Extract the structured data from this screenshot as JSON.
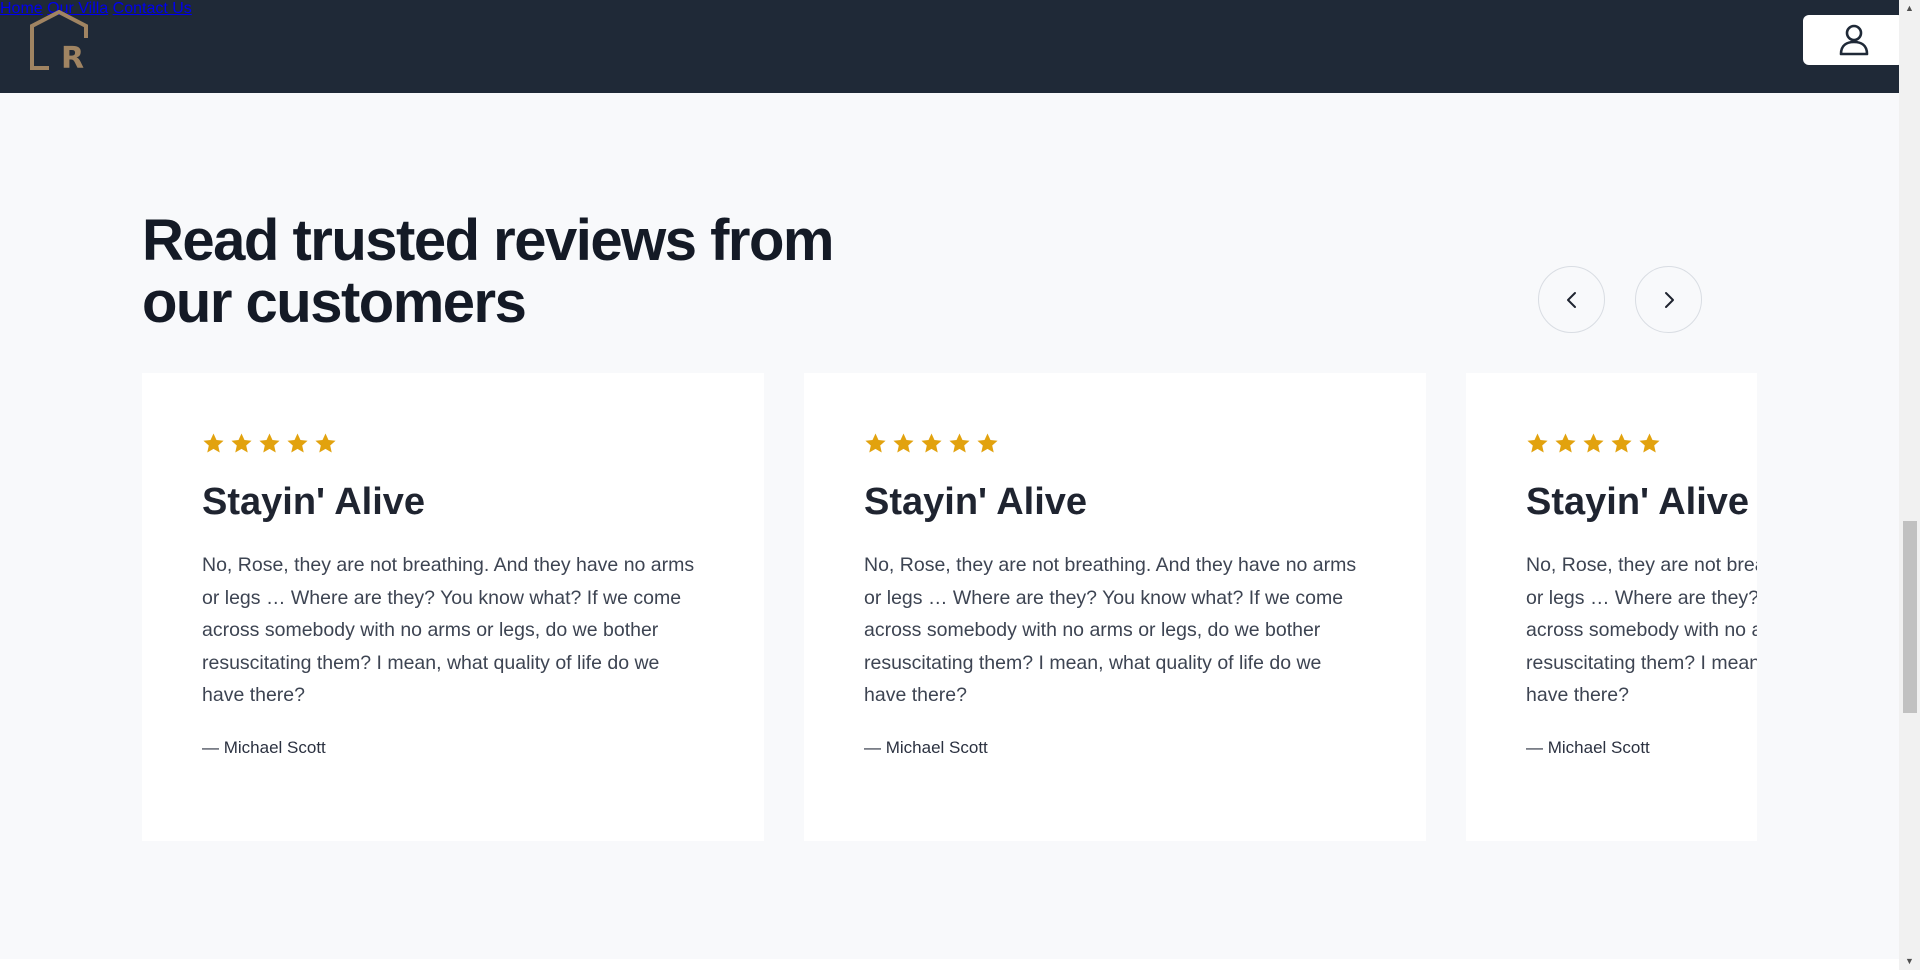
{
  "header": {
    "logo_alt": "LR",
    "nav": [
      {
        "label": "Home"
      },
      {
        "label": "Our Villa"
      },
      {
        "label": "Contact Us"
      }
    ],
    "user_icon": "user-icon"
  },
  "section": {
    "heading": "Read trusted reviews from our customers",
    "prev_icon": "chevron-left-icon",
    "next_icon": "chevron-right-icon"
  },
  "reviews": [
    {
      "rating": 5,
      "title": "Stayin' Alive",
      "text": "No, Rose, they are not breathing. And they have no arms or legs … Where are they? You know what? If we come across somebody with no arms or legs, do we bother resuscitating them? I mean, what quality of life do we have there?",
      "author": "— Michael Scott"
    },
    {
      "rating": 5,
      "title": "Stayin' Alive",
      "text": "No, Rose, they are not breathing. And they have no arms or legs … Where are they? You know what? If we come across somebody with no arms or legs, do we bother resuscitating them? I mean, what quality of life do we have there?",
      "author": "— Michael Scott"
    },
    {
      "rating": 5,
      "title": "Stayin' Alive",
      "text": "No, Rose, they are not breathing. And they have no arms or legs … Where are they? You know what? If we come across somebody with no arms or legs, do we bother resuscitating them? I mean, what quality of life do we have there?",
      "author": "— Michael Scott"
    }
  ],
  "colors": {
    "header_bg": "#1f2937",
    "page_bg": "#f8f9fb",
    "star": "#e2a20e",
    "logo": "#a08462"
  }
}
